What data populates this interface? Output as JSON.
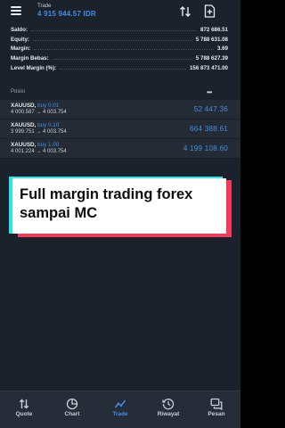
{
  "header": {
    "title": "Trade",
    "balance": "4 915 944.57 IDR"
  },
  "summary": [
    {
      "label": "Saldo:",
      "value": "872 686.51"
    },
    {
      "label": "Equity:",
      "value": "5 788 631.08"
    },
    {
      "label": "Margin:",
      "value": "3.69"
    },
    {
      "label": "Margin Bebas:",
      "value": "5 788 627.39"
    },
    {
      "label": "Level Margin (%):",
      "value": "156 873 471.00"
    }
  ],
  "positions_title": "Posisi",
  "positions": [
    {
      "symbol": "XAUUSD,",
      "direction": "buy 0.01",
      "prices": "4 000.587 → 4 003.754",
      "profit": "52 447.36"
    },
    {
      "symbol": "XAUUSD,",
      "direction": "buy 0.10",
      "prices": "3 999.751 → 4 003.754",
      "profit": "664 388.61"
    },
    {
      "symbol": "XAUUSD,",
      "direction": "buy 1.00",
      "prices": "4 001.224 → 4 003.754",
      "profit": "4 199 108.60"
    }
  ],
  "banner": {
    "text": "Full margin trading forex sampai MC"
  },
  "nav": [
    {
      "label": "Quote",
      "icon": "quote-arrows-icon",
      "active": false
    },
    {
      "label": "Chart",
      "icon": "chart-icon",
      "active": false
    },
    {
      "label": "Trade",
      "icon": "trade-line-icon",
      "active": true
    },
    {
      "label": "Riwayat",
      "icon": "history-icon",
      "active": false
    },
    {
      "label": "Pesan",
      "icon": "messages-icon",
      "active": false
    }
  ],
  "colors": {
    "accent": "#3d8fe8",
    "background": "#1c222b",
    "row_background": "#242b35",
    "banner_cyan": "#2ce6ea",
    "banner_red": "#f23a5a"
  }
}
